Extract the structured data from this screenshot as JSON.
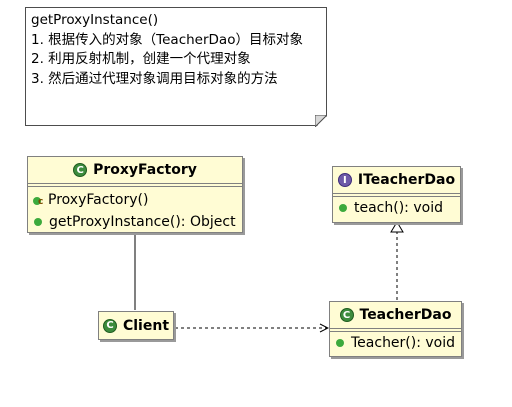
{
  "note": {
    "lines": [
      "getProxyInstance()",
      "1. 根据传入的对象（TeacherDao）目标对象",
      "2. 利用反射机制，创建一个代理对象",
      "3. 然后通过代理对象调用目标对象的方法"
    ]
  },
  "classes": {
    "proxy_factory": {
      "name": "ProxyFactory",
      "stereotype": "C",
      "members": [
        "ProxyFactory()",
        "getProxyInstance(): Object"
      ]
    },
    "iteacher_dao": {
      "name": "ITeacherDao",
      "stereotype": "I",
      "members": [
        "teach(): void"
      ]
    },
    "client": {
      "name": "Client",
      "stereotype": "C"
    },
    "teacher_dao": {
      "name": "TeacherDao",
      "stereotype": "C",
      "members": [
        "Teacher(): void"
      ]
    }
  },
  "colors": {
    "class_fill": "#fffcd4",
    "border": "#808080",
    "class_icon": "#3d8c3d",
    "interface_icon": "#6e5aa8",
    "member_dot": "#3caa3c"
  }
}
